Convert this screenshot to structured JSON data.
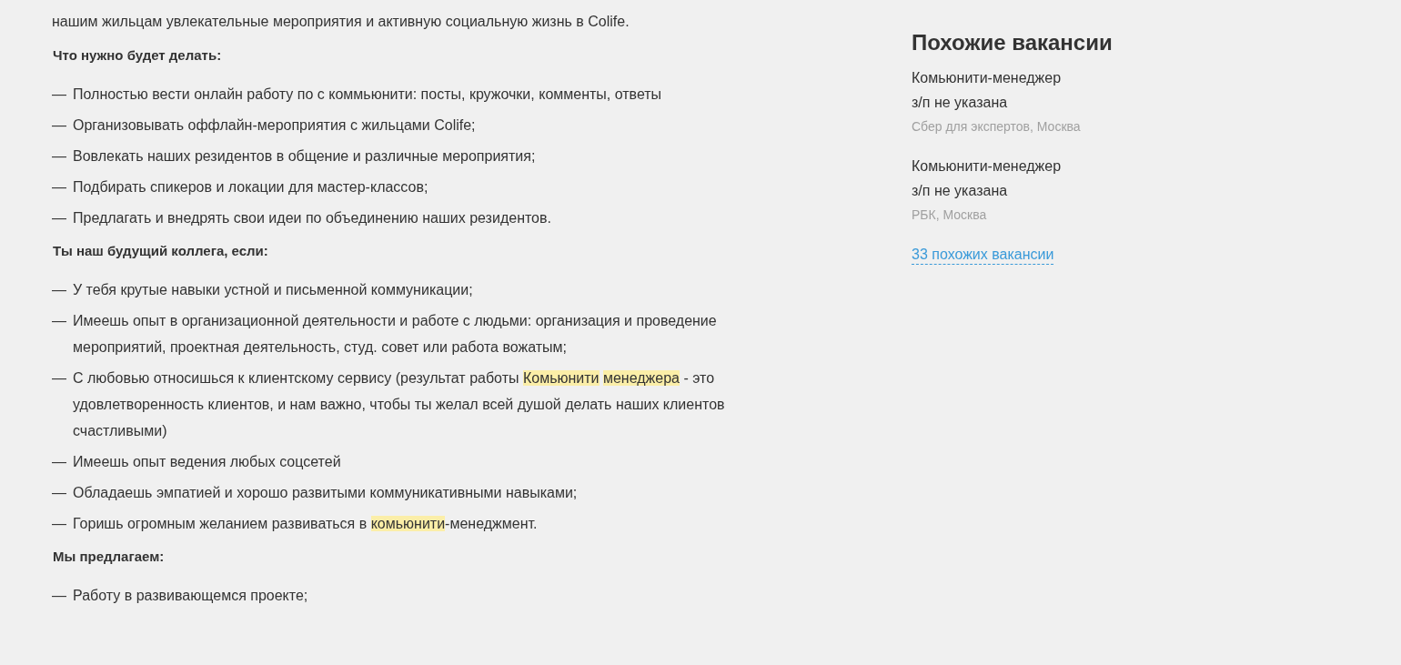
{
  "description": [
    {
      "kind": "paragraph",
      "parts": [
        {
          "text": "нашим жильцам увлекательные мероприятия и активную социальную жизнь в Colife.",
          "highlight": false
        }
      ]
    },
    {
      "kind": "heading",
      "parts": [
        {
          "text": "Что нужно будет делать:",
          "highlight": false
        }
      ]
    },
    {
      "kind": "item",
      "parts": [
        {
          "text": "Полностью вести онлайн работу по с коммьюнити: посты, кружочки, комменты, ответы",
          "highlight": false
        }
      ]
    },
    {
      "kind": "item",
      "parts": [
        {
          "text": "Организовывать оффлайн-мероприятия с жильцами Colife;",
          "highlight": false
        }
      ]
    },
    {
      "kind": "item",
      "parts": [
        {
          "text": "Вовлекать наших резидентов в общение и различные мероприятия;",
          "highlight": false
        }
      ]
    },
    {
      "kind": "item",
      "parts": [
        {
          "text": "Подбирать спикеров и локации для мастер-классов;",
          "highlight": false
        }
      ]
    },
    {
      "kind": "item",
      "parts": [
        {
          "text": "Предлагать и внедрять свои идеи по объединению наших резидентов.",
          "highlight": false
        }
      ]
    },
    {
      "kind": "heading",
      "parts": [
        {
          "text": "Ты наш будущий коллега, если:",
          "highlight": false
        }
      ]
    },
    {
      "kind": "item",
      "parts": [
        {
          "text": "У тебя крутые навыки устной и письменной коммуникации;",
          "highlight": false
        }
      ]
    },
    {
      "kind": "item",
      "parts": [
        {
          "text": "Имеешь опыт в организационной деятельности и работе с людьми: организация и проведение мероприятий, проектная деятельность, студ. совет или работа вожатым;",
          "highlight": false
        }
      ]
    },
    {
      "kind": "item",
      "parts": [
        {
          "text": "С любовью относишься к клиентскому сервису (результат работы ",
          "highlight": false
        },
        {
          "text": "Комьюнити менеджера",
          "highlight": true
        },
        {
          "text": " - это удовлетворенность клиентов, и нам важно, чтобы ты желал всей душой делать наших клиентов счастливыми)",
          "highlight": false
        }
      ]
    },
    {
      "kind": "item",
      "parts": [
        {
          "text": "Имеешь опыт ведения любых соцсетей",
          "highlight": false
        }
      ]
    },
    {
      "kind": "item",
      "parts": [
        {
          "text": "Обладаешь эмпатией и хорошо развитыми коммуникативными навыками;",
          "highlight": false
        }
      ]
    },
    {
      "kind": "item",
      "parts": [
        {
          "text": "Горишь огромным желанием развиваться в ",
          "highlight": false
        },
        {
          "text": "комьюнити",
          "highlight": true
        },
        {
          "text": "-менеджмент.",
          "highlight": false
        }
      ]
    },
    {
      "kind": "heading",
      "parts": [
        {
          "text": "Мы предлагаем:",
          "highlight": false
        }
      ]
    },
    {
      "kind": "item",
      "parts": [
        {
          "text": "Работу в развивающемся проекте;",
          "highlight": false
        }
      ]
    }
  ],
  "bullet": "—",
  "similar": {
    "title": "Похожие вакансии",
    "vacancies": [
      {
        "title": "Комьюнити-менеджер",
        "salary": "з/п не указана",
        "company": "Сбер для экспертов, Москва"
      },
      {
        "title": "Комьюнити-менеджер",
        "salary": "з/п не указана",
        "company": "РБК, Москва"
      }
    ],
    "more_link": "33 похожих вакансии"
  }
}
